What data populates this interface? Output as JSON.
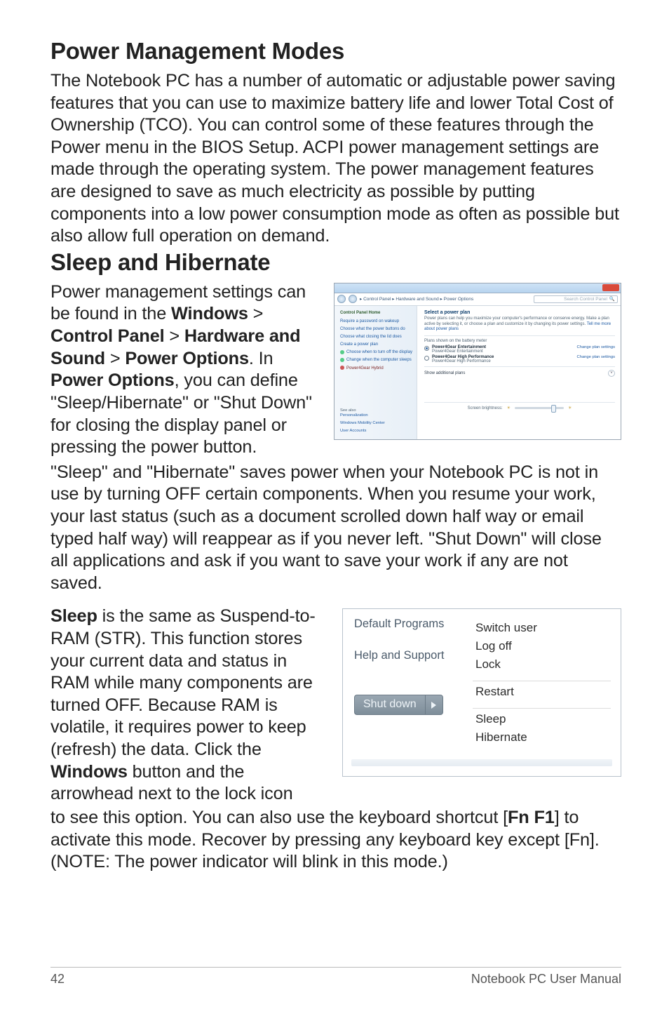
{
  "h1": "Power Management Modes",
  "p1": "The Notebook PC has a number of automatic or adjustable power saving features that you can use to maximize battery life and lower Total Cost of Ownership (TCO). You can control some of these features through the Power menu in the BIOS Setup. ACPI power management settings are made through the operating system. The power management features are designed to save as much electricity as possible by putting components into a low power consumption mode as often as possible but also allow full operation on demand.",
  "h2": "Sleep and Hibernate",
  "p2a_1": "Power management settings can be found in the ",
  "p2a_b1": "Windows",
  "p2a_2": " > ",
  "p2a_b2": "Control Panel",
  "p2a_3": " > ",
  "p2a_b3": "Hardware and Sound",
  "p2a_4": " > ",
  "p2a_b4": "Power Options",
  "p2a_5": ". In ",
  "p2a_b5": "Power Options",
  "p2a_6": ", you can define \"Sleep/Hibernate\" or \"Shut Down\" for closing the display panel or pressing the power button.",
  "p2b": "\"Sleep\" and \"Hibernate\" saves power when your Notebook PC is not in use by turning OFF certain components. When you resume your work, your last status (such as a document scrolled down half way or email typed half way) will reappear as if you never left. \"Shut Down\" will close all applications and ask if you want to save your work if any are not saved.",
  "p3a_b1": "Sleep",
  "p3a_1": " is the same as Suspend-to-RAM (STR). This function stores your current data and status in RAM while many components are turned OFF. Because RAM is volatile, it requires power to keep (refresh) the data. Click the ",
  "p3a_b2": "Windows",
  "p3a_2": " button and the arrowhead next to the lock icon",
  "p3b_1": "to see this option. You can also use the keyboard shortcut [",
  "p3b_b1": "Fn F1",
  "p3b_2": "] to activate this mode. Recover by pressing any keyboard key except [Fn]. (NOTE: The power indicator will blink in this mode.)",
  "po": {
    "breadcrumb": "▸ Control Panel ▸ Hardware and Sound ▸ Power Options",
    "search_hint": "Search Control Panel",
    "side_header": "Control Panel Home",
    "side_links": [
      "Require a password on wakeup",
      "Choose what the power buttons do",
      "Choose what closing the lid does",
      "Create a power plan",
      "Choose when to turn off the display",
      "Change when the computer sleeps"
    ],
    "side_selected": "Power4Gear Hybrid",
    "see_also": "See also",
    "see_also_items": [
      "Personalization",
      "Windows Mobility Center",
      "User Accounts"
    ],
    "title": "Select a power plan",
    "desc": "Power plans can help you maximize your computer's performance or conserve energy. Make a plan active by selecting it, or choose a plan and customize it by changing its power settings. ",
    "desc_link": "Tell me more about power plans",
    "group1": "Plans shown on the battery meter",
    "plan1_name": "Power4Gear Entertainment",
    "plan1_sub": "Power4Gear Entertainment",
    "plan2_name": "Power4Gear High Performance",
    "plan2_sub": "Power4Gear High Performance",
    "change": "Change plan settings",
    "hide": "Show additional plans",
    "brightness": "Screen brightness:"
  },
  "sm": {
    "left": {
      "l1": "Default Programs",
      "l2": "Help and Support",
      "shut": "Shut down"
    },
    "right": {
      "g1": [
        "Switch user",
        "Log off",
        "Lock"
      ],
      "g2": [
        "Restart"
      ],
      "g3": [
        "Sleep",
        "Hibernate"
      ]
    }
  },
  "footer": {
    "page": "42",
    "title": "Notebook PC User Manual"
  }
}
